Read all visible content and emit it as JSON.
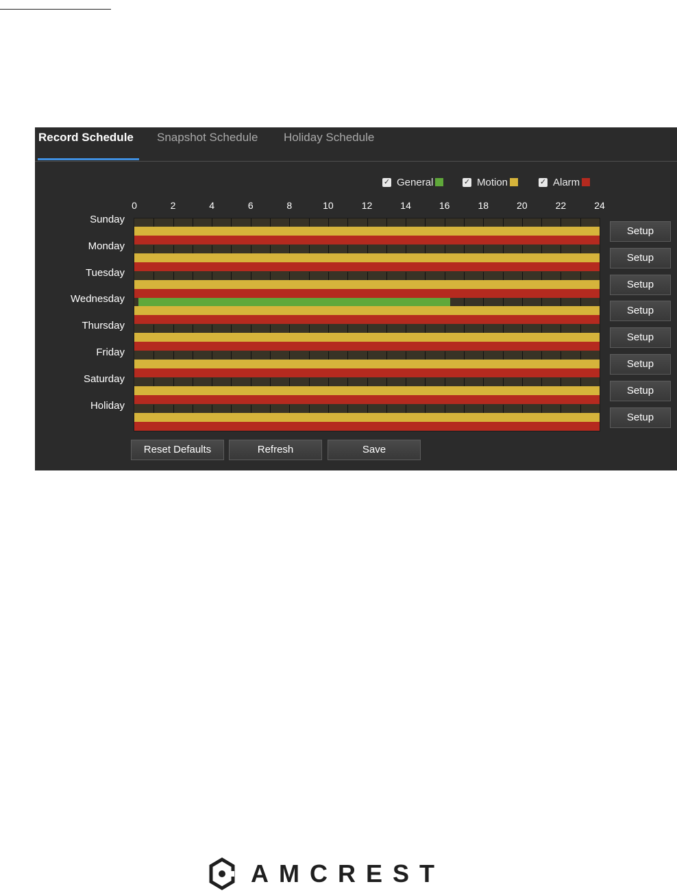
{
  "tabs": [
    {
      "label": "Record Schedule",
      "active": true
    },
    {
      "label": "Snapshot Schedule",
      "active": false
    },
    {
      "label": "Holiday Schedule",
      "active": false
    }
  ],
  "legend": [
    {
      "label": "General",
      "checked": true,
      "color": "#5fa83a"
    },
    {
      "label": "Motion",
      "checked": true,
      "color": "#d6b43b"
    },
    {
      "label": "Alarm",
      "checked": true,
      "color": "#b52a1f"
    }
  ],
  "axis": {
    "ticks": [
      "0",
      "2",
      "4",
      "6",
      "8",
      "10",
      "12",
      "14",
      "16",
      "18",
      "20",
      "22",
      "24"
    ]
  },
  "schedule": {
    "days": [
      "Sunday",
      "Monday",
      "Tuesday",
      "Wednesday",
      "Thursday",
      "Friday",
      "Saturday",
      "Holiday"
    ],
    "setup_label": "Setup",
    "rows": [
      {
        "general": null,
        "motion": [
          0,
          24
        ],
        "alarm": [
          0,
          24
        ]
      },
      {
        "general": null,
        "motion": [
          0,
          24
        ],
        "alarm": [
          0,
          24
        ]
      },
      {
        "general": null,
        "motion": [
          0,
          24
        ],
        "alarm": [
          0,
          24
        ]
      },
      {
        "general": [
          0.2,
          16.3
        ],
        "motion": [
          0,
          24
        ],
        "alarm": [
          0,
          24
        ]
      },
      {
        "general": null,
        "motion": [
          0,
          24
        ],
        "alarm": [
          0,
          24
        ]
      },
      {
        "general": null,
        "motion": [
          0,
          24
        ],
        "alarm": [
          0,
          24
        ]
      },
      {
        "general": null,
        "motion": [
          0,
          24
        ],
        "alarm": [
          0,
          24
        ]
      },
      {
        "general": null,
        "motion": [
          0,
          24
        ],
        "alarm": [
          0,
          24
        ]
      }
    ]
  },
  "buttons": {
    "reset": "Reset Defaults",
    "refresh": "Refresh",
    "save": "Save"
  },
  "logo": {
    "text": "AMCREST"
  },
  "colors": {
    "panel": "#2b2b2b",
    "accent": "#3f8fe0",
    "general": "#5fa83a",
    "motion": "#d6b43b",
    "alarm": "#b52a1f"
  }
}
